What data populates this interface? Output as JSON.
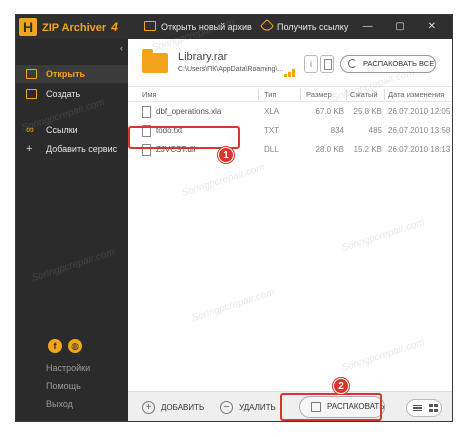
{
  "app": {
    "logo_letter": "H",
    "title": "ZIP Archiver",
    "version": "4",
    "accent": "#f2a51a"
  },
  "toolbar": {
    "open_archive": "Открыть новый архив",
    "get_link": "Получить ссылку",
    "window_controls": "— ▢ ✕"
  },
  "sidebar": {
    "items": [
      {
        "label": "Открыть",
        "icon": "folder-icon",
        "active": true
      },
      {
        "label": "Создать",
        "icon": "new-archive-icon",
        "active": false
      },
      {
        "label": "Ссылки",
        "icon": "link-icon",
        "active": false
      },
      {
        "label": "Добавить сервис",
        "icon": "plus-icon",
        "active": false
      }
    ],
    "social": [
      "f",
      "◍"
    ],
    "bottom": [
      "Настройки",
      "Помощь",
      "Выход"
    ]
  },
  "archive": {
    "name": "Library.rar",
    "path": "C:\\Users\\ПК\\AppData\\Roaming\\...",
    "extract_all": "РАСПАКОВАТЬ ВСЕ"
  },
  "table": {
    "headers": [
      "Имя",
      "Тип",
      "Размер",
      "Сжатый",
      "Дата изменения"
    ],
    "rows": [
      {
        "name": "dbf_operations.xla",
        "type": "XLA",
        "size": "67.0 KB",
        "compressed": "25.8 KB",
        "date": "26.07.2010 12:05"
      },
      {
        "name": "todo.txt",
        "type": "TXT",
        "size": "834",
        "compressed": "485",
        "date": "26.07.2010 13:58"
      },
      {
        "name": "ZJVCST.dll",
        "type": "DLL",
        "size": "28.0 KB",
        "compressed": "15.2 KB",
        "date": "26.07.2010 18:13"
      }
    ]
  },
  "annotations": {
    "step1": "1",
    "step2": "2",
    "color": "#d9352f"
  },
  "bottombar": {
    "add": "ДОБАВИТЬ",
    "delete": "УДАЛИТЬ",
    "extract": "РАСПАКОВАТЬ"
  },
  "watermark": "Soringpcrepair.com"
}
